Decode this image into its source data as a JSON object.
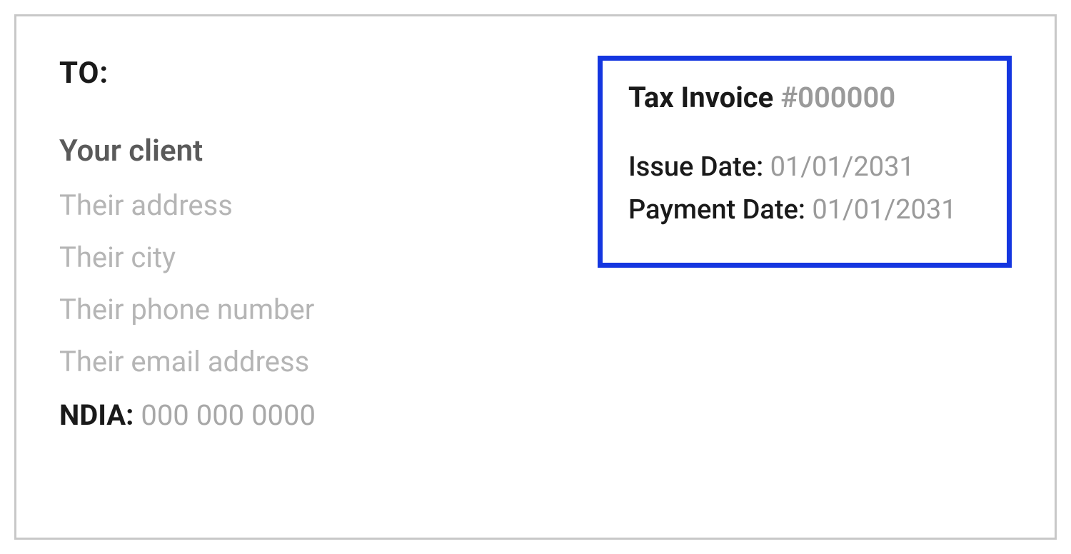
{
  "to": {
    "label": "TO:",
    "client_name": "Your client",
    "address": "Their address",
    "city": "Their city",
    "phone": "Their phone number",
    "email": "Their email address",
    "ndia_label": "NDIA:",
    "ndia_value": " 000 000 0000"
  },
  "invoice": {
    "title": "Tax Invoice ",
    "number": "#000000",
    "issue_date_label": "Issue Date: ",
    "issue_date_value": "01/01/2031",
    "payment_date_label": "Payment Date: ",
    "payment_date_value": "01/01/2031"
  }
}
